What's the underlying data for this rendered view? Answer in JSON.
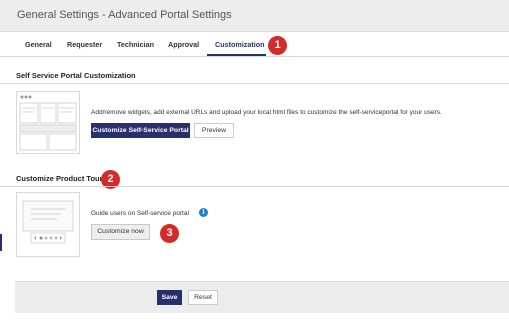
{
  "window": {
    "title": "General Settings - Advanced Portal Settings"
  },
  "tabs": [
    {
      "label": "General"
    },
    {
      "label": "Requester"
    },
    {
      "label": "Technician"
    },
    {
      "label": "Approval"
    },
    {
      "label": "Customization",
      "active": true
    }
  ],
  "markers": [
    "1",
    "2",
    "3"
  ],
  "self_service": {
    "title": "Self Service Portal Customization",
    "description": "Add/remove widgets, add external URLs and upload your local html files to customize the self-serviceportal for your users.",
    "customize_button": "Customize Self-Service Portal",
    "preview_button": "Preview"
  },
  "product_tour": {
    "title": "Customize Product Tour",
    "description": "Guide users on Self-service portal",
    "info_icon": "i",
    "customize_button": "Customize now"
  },
  "footer": {
    "save_button": "Save",
    "reset_button": "Reset"
  },
  "colors": {
    "primary": "#28306b",
    "marker": "#d42a2a",
    "info": "#1a7fd4"
  }
}
